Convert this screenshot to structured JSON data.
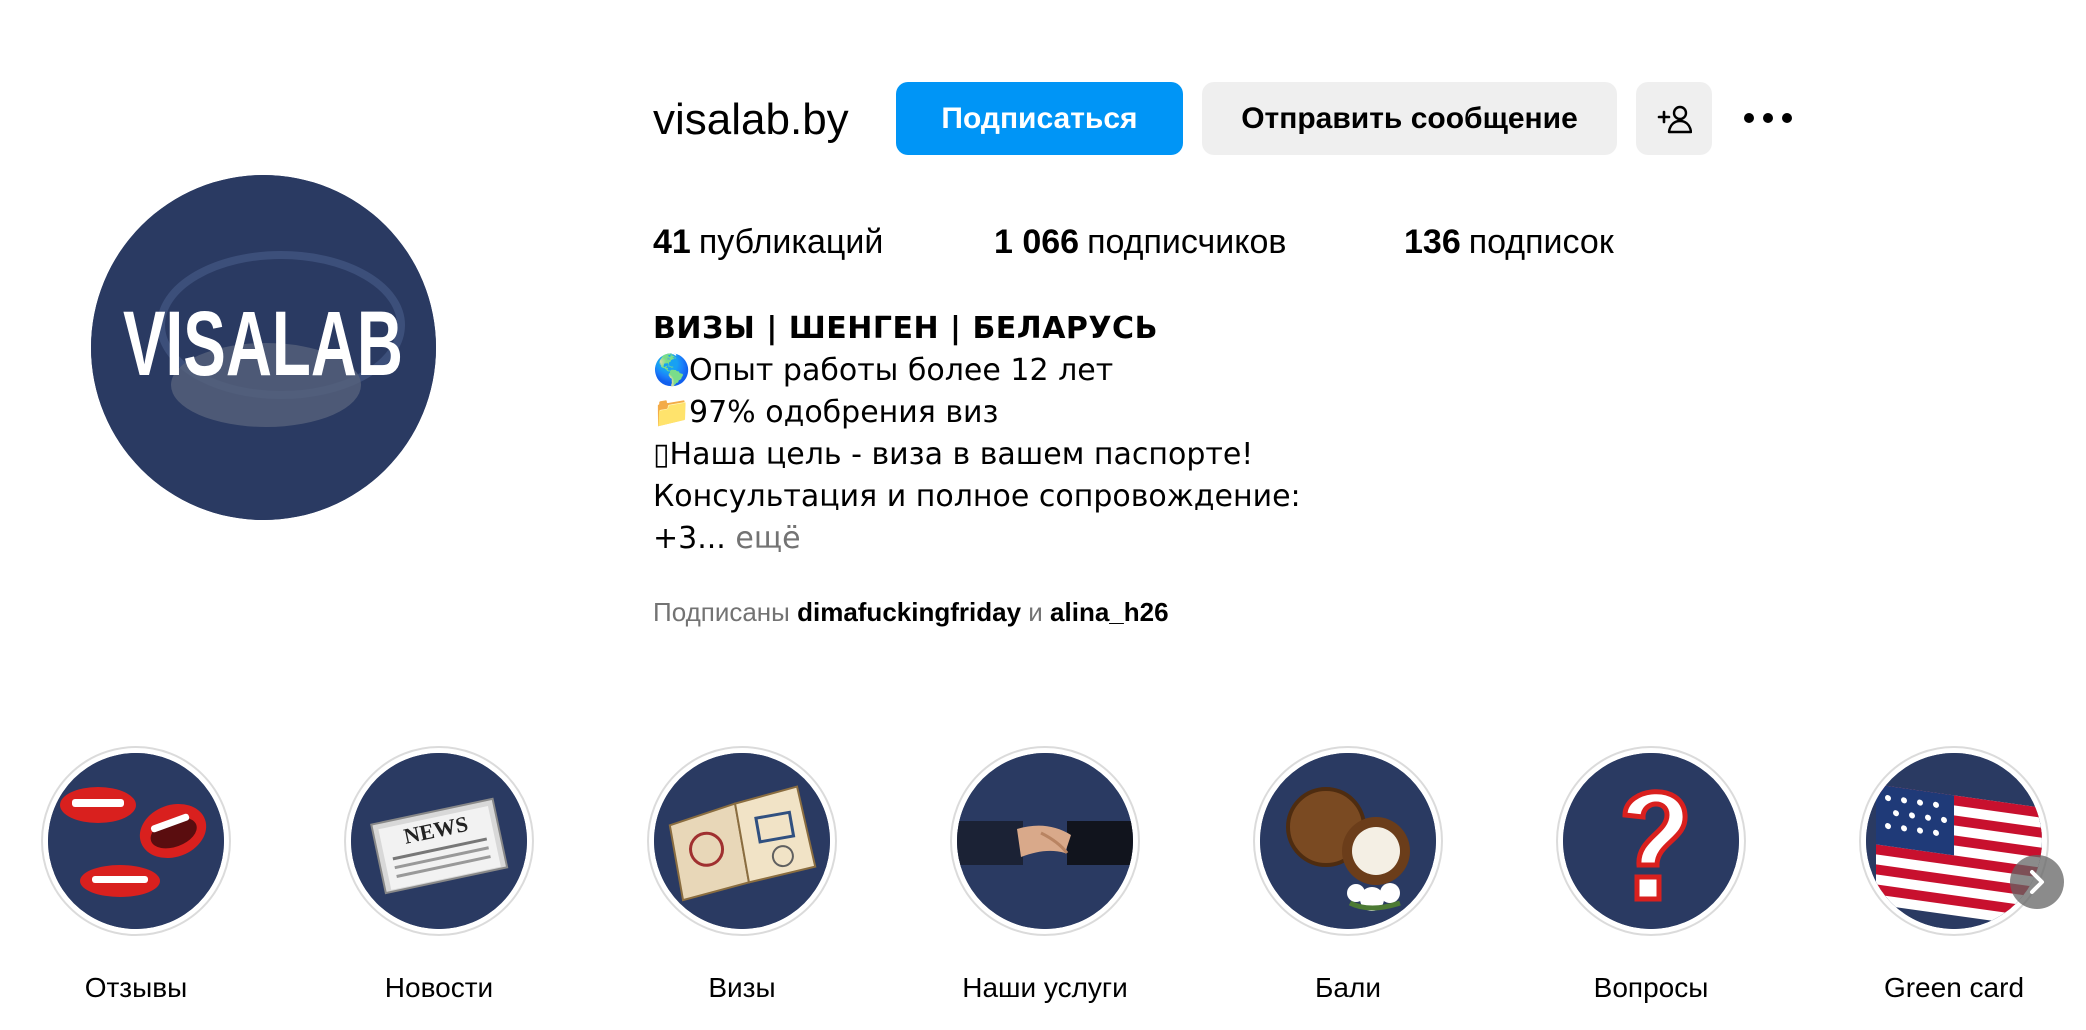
{
  "profile": {
    "username": "visalab.by",
    "avatar_text": "VISALAB",
    "buttons": {
      "follow": "Подписаться",
      "message": "Отправить сообщение",
      "add_user_icon": "add-person-icon",
      "more_icon": "more-horizontal-icon"
    },
    "stats": {
      "posts_num": "41",
      "posts_label": "публикаций",
      "followers_num": "1 066",
      "followers_label": "подписчиков",
      "following_num": "136",
      "following_label": "подписок"
    },
    "bio": {
      "title": "ВИЗЫ | ШЕНГЕН | БЕЛАРУСЬ",
      "line1_emoji": "🌎",
      "line1": "Опыт работы более 12 лет",
      "line2_emoji": "📁",
      "line2": "97% одобрения виз",
      "line3_emoji": "▯",
      "line3": "Наша цель - виза в вашем паспорте!",
      "line4": "Консультация и полное сопровождение:",
      "line5": "+3...",
      "more": "ещё"
    },
    "followed_by": {
      "prefix": "Подписаны",
      "user1": "dimafuckingfriday",
      "conj": "и",
      "user2": "alina_h26"
    }
  },
  "highlights": [
    {
      "label": "Отзывы",
      "icon": "lips-icon"
    },
    {
      "label": "Новости",
      "icon": "newspaper-icon"
    },
    {
      "label": "Визы",
      "icon": "passport-icon"
    },
    {
      "label": "Наши услуги",
      "icon": "handshake-icon"
    },
    {
      "label": "Бали",
      "icon": "coconut-icon"
    },
    {
      "label": "Вопросы",
      "icon": "question-mark-icon"
    },
    {
      "label": "Green card",
      "icon": "us-flag-icon"
    }
  ],
  "colors": {
    "accent": "#0095f6",
    "secondary_button": "#efefef",
    "avatar_bg": "#2a3a62",
    "muted_text": "#737373"
  }
}
